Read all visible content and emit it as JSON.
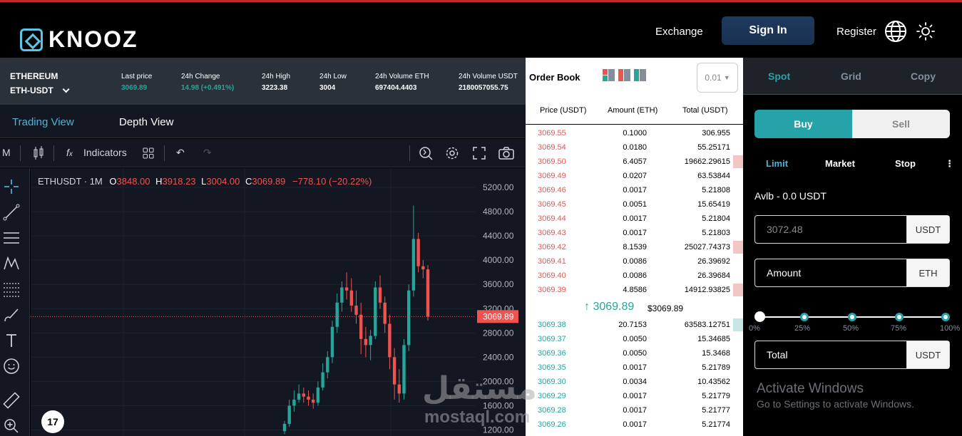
{
  "header": {
    "brand": "KNOOZ",
    "nav_exchange": "Exchange",
    "signin_label": "Sign In",
    "register_label": "Register"
  },
  "ticker": {
    "base_name": "ETHEREUM",
    "pair": "ETH-USDT",
    "stats": [
      {
        "label": "Last price",
        "value": "3069.89",
        "color": "#26a69a"
      },
      {
        "label": "24h Change",
        "value": "14.98 (+0.491%)",
        "color": "#26a69a"
      },
      {
        "label": "24h High",
        "value": "3223.38",
        "color": "#ffffff"
      },
      {
        "label": "24h Low",
        "value": "3004",
        "color": "#ffffff"
      },
      {
        "label": "24h Volume ETH",
        "value": "697404.4403",
        "color": "#ffffff"
      },
      {
        "label": "24h Volume USDT",
        "value": "2180057055.75",
        "color": "#ffffff"
      }
    ]
  },
  "views": {
    "trading": "Trading View",
    "depth": "Depth View"
  },
  "toolbar": {
    "interval": "M",
    "indicators": "Indicators"
  },
  "chart": {
    "symbol": "ETHUSDT · 1M",
    "o_label": "O",
    "o": "3848.00",
    "h_label": "H",
    "h": "3918.23",
    "l_label": "L",
    "l": "3004.00",
    "c_label": "C",
    "c": "3069.89",
    "change": "−778.10 (−20.22%)",
    "price_tag": "3069.89"
  },
  "chart_data": {
    "type": "candlestick",
    "title": "ETHUSDT · 1M",
    "ylim": [
      1100,
      5400
    ],
    "yticks": [
      "5200.00",
      "4800.00",
      "4400.00",
      "4000.00",
      "3600.00",
      "3200.00",
      "2800.00",
      "2400.00",
      "2000.00",
      "1600.00",
      "1200.00"
    ],
    "last_price": 3069.89,
    "candles": [
      [
        1180,
        1350,
        1130,
        1300
      ],
      [
        1300,
        1700,
        1250,
        1600
      ],
      [
        1600,
        1850,
        1500,
        1700
      ],
      [
        1700,
        1950,
        1650,
        1800
      ],
      [
        1800,
        1900,
        1650,
        1750
      ],
      [
        1750,
        1850,
        1600,
        1700
      ],
      [
        1700,
        1800,
        1550,
        1650
      ],
      [
        1650,
        2000,
        1600,
        1900
      ],
      [
        1900,
        2300,
        1850,
        2150
      ],
      [
        2150,
        2500,
        2050,
        2400
      ],
      [
        2400,
        3000,
        2300,
        2900
      ],
      [
        2900,
        3450,
        2800,
        3300
      ],
      [
        3300,
        3650,
        3150,
        3550
      ],
      [
        3550,
        3800,
        3350,
        3500
      ],
      [
        3500,
        3700,
        3150,
        3250
      ],
      [
        3250,
        3500,
        2950,
        3100
      ],
      [
        3100,
        3300,
        2450,
        2700
      ],
      [
        2700,
        2900,
        2400,
        2600
      ],
      [
        2600,
        2850,
        2350,
        2750
      ],
      [
        2750,
        3650,
        2700,
        3550
      ],
      [
        3550,
        3750,
        3200,
        3300
      ],
      [
        3300,
        3400,
        2800,
        2950
      ],
      [
        2950,
        3100,
        2200,
        2400
      ],
      [
        2400,
        2550,
        1700,
        1950
      ],
      [
        1950,
        2200,
        1650,
        1800
      ],
      [
        1800,
        2700,
        1700,
        2600
      ],
      [
        2600,
        3600,
        2500,
        3500
      ],
      [
        3500,
        4900,
        3400,
        4350
      ],
      [
        4350,
        4450,
        3800,
        3900
      ],
      [
        3900,
        4000,
        3700,
        3848
      ],
      [
        3848,
        3918,
        3004,
        3070
      ]
    ]
  },
  "orderbook": {
    "title": "Order Book",
    "precision": "0.01",
    "col_price": "Price (USDT)",
    "col_amount": "Amount (ETH)",
    "col_total": "Total (USDT)",
    "asks": [
      {
        "p": "3069.55",
        "a": "0.1000",
        "t": "306.955",
        "bar": 0
      },
      {
        "p": "3069.54",
        "a": "0.0180",
        "t": "55.25171",
        "bar": 0
      },
      {
        "p": "3069.50",
        "a": "6.4057",
        "t": "19662.29615",
        "bar": 1
      },
      {
        "p": "3069.49",
        "a": "0.0207",
        "t": "63.53844",
        "bar": 0
      },
      {
        "p": "3069.46",
        "a": "0.0017",
        "t": "5.21808",
        "bar": 0
      },
      {
        "p": "3069.45",
        "a": "0.0051",
        "t": "15.65419",
        "bar": 0
      },
      {
        "p": "3069.44",
        "a": "0.0017",
        "t": "5.21804",
        "bar": 0
      },
      {
        "p": "3069.43",
        "a": "0.0017",
        "t": "5.21803",
        "bar": 0
      },
      {
        "p": "3069.42",
        "a": "8.1539",
        "t": "25027.74373",
        "bar": 1
      },
      {
        "p": "3069.41",
        "a": "0.0086",
        "t": "26.39692",
        "bar": 0
      },
      {
        "p": "3069.40",
        "a": "0.0086",
        "t": "26.39684",
        "bar": 0
      },
      {
        "p": "3069.39",
        "a": "4.8586",
        "t": "14912.93825",
        "bar": 1
      }
    ],
    "mid_price": "3069.89",
    "mid_usd": "$3069.89",
    "bids": [
      {
        "p": "3069.38",
        "a": "20.7153",
        "t": "63583.12751",
        "bar": 1
      },
      {
        "p": "3069.37",
        "a": "0.0050",
        "t": "15.34685",
        "bar": 0
      },
      {
        "p": "3069.36",
        "a": "0.0050",
        "t": "15.3468",
        "bar": 0
      },
      {
        "p": "3069.35",
        "a": "0.0017",
        "t": "5.21789",
        "bar": 0
      },
      {
        "p": "3069.30",
        "a": "0.0034",
        "t": "10.43562",
        "bar": 0
      },
      {
        "p": "3069.29",
        "a": "0.0017",
        "t": "5.21779",
        "bar": 0
      },
      {
        "p": "3069.28",
        "a": "0.0017",
        "t": "5.21777",
        "bar": 0
      },
      {
        "p": "3069.26",
        "a": "0.0017",
        "t": "5.21774",
        "bar": 0
      }
    ]
  },
  "trade": {
    "tabs": [
      "Spot",
      "Grid",
      "Copy"
    ],
    "buy": "Buy",
    "sell": "Sell",
    "order_types": [
      "Limit",
      "Market",
      "Stop"
    ],
    "more": "⋮",
    "available": "Avlb - 0.0 USDT",
    "price_value": "3072.48",
    "price_unit": "USDT",
    "amount_label": "Amount",
    "amount_unit": "ETH",
    "slider_value": 0,
    "slider_marks": [
      "0%",
      "25%",
      "50%",
      "75%",
      "100%"
    ],
    "total_label": "Total",
    "total_unit": "USDT"
  },
  "overlay": {
    "activate_title": "Activate Windows",
    "activate_sub": "Go to Settings to activate Windows.",
    "watermark_ar": "مستقل",
    "watermark_lat": "mostaql.com"
  },
  "colors": {
    "up": "#26a69a",
    "down": "#ef5350",
    "accent": "#26a3a8",
    "tab_active": "#4fb3d9"
  }
}
